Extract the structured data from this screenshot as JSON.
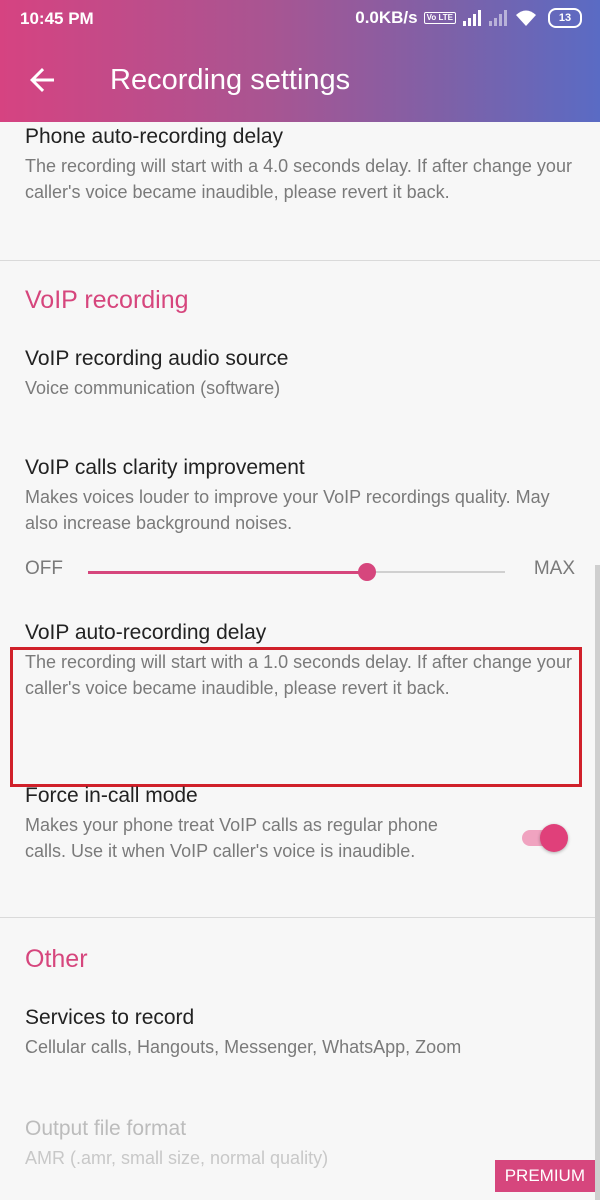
{
  "status_bar": {
    "time": "10:45 PM",
    "net_speed": "0.0KB/s",
    "volte": "Vo LTE",
    "battery": "13"
  },
  "app_bar": {
    "title": "Recording settings",
    "back_icon": "arrow-back-icon"
  },
  "prefs": {
    "phone_delay": {
      "title": "Phone auto-recording delay",
      "summary": "The recording will start with a 4.0 seconds delay. If after change your caller's voice became inaudible, please revert it back."
    },
    "voip_section": "VoIP recording",
    "voip_source": {
      "title": "VoIP recording audio source",
      "summary": "Voice communication (software)"
    },
    "voip_clarity": {
      "title": "VoIP calls clarity improvement",
      "summary": "Makes voices louder to improve your VoIP recordings quality. May also increase background noises.",
      "min_label": "OFF",
      "max_label": "MAX",
      "level": 0.67
    },
    "voip_delay": {
      "title": "VoIP auto-recording delay",
      "summary": "The recording will start with a 1.0 seconds delay. If after change your caller's voice became inaudible, please revert it back."
    },
    "force_in_call": {
      "title": "Force in-call mode",
      "summary": "Makes your phone treat VoIP calls as regular phone calls. Use it when VoIP caller's voice is inaudible.",
      "enabled": true
    },
    "other_section": "Other",
    "services": {
      "title": "Services to record",
      "summary": "Cellular calls, Hangouts, Messenger, WhatsApp, Zoom"
    },
    "output_format": {
      "title": "Output file format",
      "summary": "AMR (.amr, small size, normal quality)"
    },
    "premium_badge": "PREMIUM"
  },
  "colors": {
    "accent": "#d6467d",
    "highlight_border": "#d0202a"
  }
}
